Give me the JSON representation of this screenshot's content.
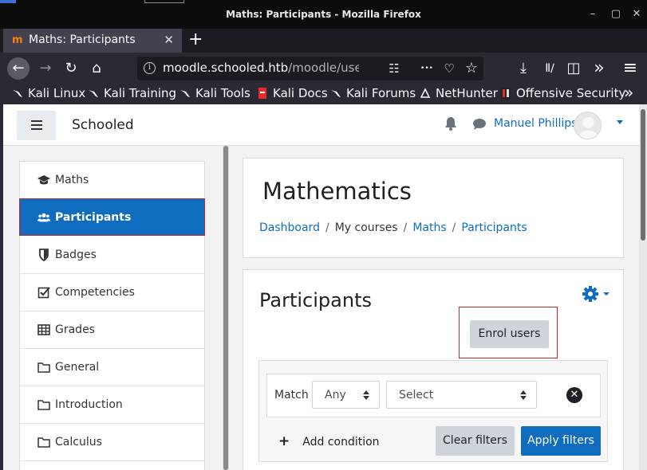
{
  "window": {
    "title": "Maths: Participants - Mozilla Firefox",
    "min_glyph": "–",
    "max_glyph": "▢",
    "close_glyph": "✕"
  },
  "tabs": [
    {
      "label": "Maths: Participants",
      "close_glyph": "✕",
      "favicon_glyph": "m"
    }
  ],
  "newtab_glyph": "+",
  "nav": {
    "back_glyph": "←",
    "forward_glyph": "→",
    "reload_glyph": "↻",
    "home_glyph": "⌂",
    "url_host": "moodle.schooled.htb",
    "url_path": "/moodle/user/inc",
    "reader_glyph": "☷",
    "more_glyph": "•••",
    "pocket_glyph": "♡",
    "star_glyph": "☆",
    "download_glyph": "⤓",
    "library_glyph": "Ⅱ∕",
    "sidebar_glyph": "◫",
    "overflow_glyph": "»",
    "menu_glyph": "≡"
  },
  "bookmarks": [
    {
      "label": "Kali Linux"
    },
    {
      "label": "Kali Training"
    },
    {
      "label": "Kali Tools"
    },
    {
      "label": "Kali Docs"
    },
    {
      "label": "Kali Forums"
    },
    {
      "label": "NetHunter"
    },
    {
      "label": "Offensive Security"
    }
  ],
  "bookmarks_overflow": "»",
  "moodle": {
    "site_name": "Schooled",
    "user_name": "Manuel Phillips"
  },
  "sidebar": {
    "items": [
      {
        "label": "Maths",
        "icon": "graduation-cap-icon"
      },
      {
        "label": "Participants",
        "icon": "users-icon",
        "active": true
      },
      {
        "label": "Badges",
        "icon": "shield-icon"
      },
      {
        "label": "Competencies",
        "icon": "check-square-icon"
      },
      {
        "label": "Grades",
        "icon": "table-icon"
      },
      {
        "label": "General",
        "icon": "folder-icon"
      },
      {
        "label": "Introduction",
        "icon": "folder-icon"
      },
      {
        "label": "Calculus",
        "icon": "folder-icon"
      }
    ]
  },
  "course": {
    "title": "Mathematics",
    "breadcrumb": [
      "Dashboard",
      "My courses",
      "Maths",
      "Participants"
    ],
    "breadcrumb_sep": "/"
  },
  "participants": {
    "title": "Participants",
    "enrol_label": "Enrol users",
    "match_label": "Match",
    "match_value": "Any",
    "select_value": "Select",
    "remove_glyph": "✕",
    "add_condition_plus": "+",
    "add_condition_label": "Add condition",
    "clear_label": "Clear filters",
    "apply_label": "Apply filters"
  },
  "colors": {
    "accent": "#0f6cbf",
    "highlight_border": "#c02a2a"
  }
}
